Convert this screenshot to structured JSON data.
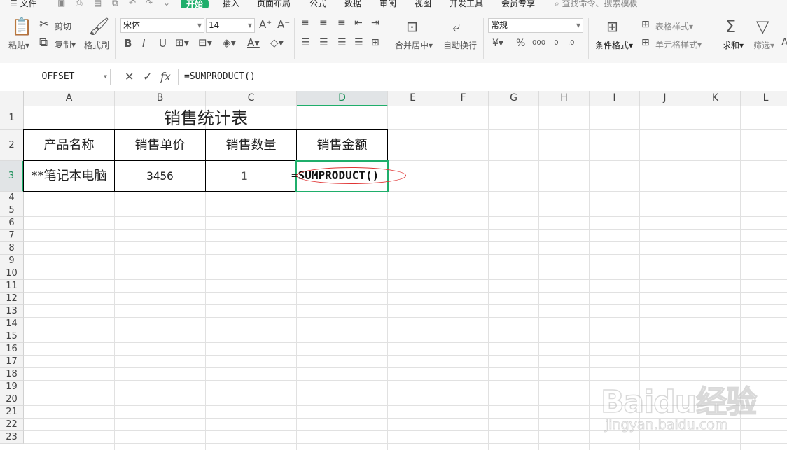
{
  "menu": {
    "file": "文件",
    "tabs": [
      "开始",
      "插入",
      "页面布局",
      "公式",
      "数据",
      "审阅",
      "视图",
      "开发工具",
      "会员专享"
    ],
    "search_placeholder": "查找命令、搜索模板"
  },
  "ribbon": {
    "paste": "粘贴",
    "cut": "剪切",
    "copy": "复制",
    "format_painter": "格式刷",
    "font_name": "宋体",
    "font_size": "14",
    "merge_center": "合并居中",
    "wrap_text": "自动换行",
    "number_format": "常规",
    "conditional_format": "条件格式",
    "table_style": "表格样式",
    "cell_style": "单元格样式",
    "sum": "求和",
    "filter": "筛选"
  },
  "formula_bar": {
    "name_box": "OFFSET",
    "fx_label": "fx",
    "formula": "=SUMPRODUCT()"
  },
  "sheet": {
    "columns": [
      "A",
      "B",
      "C",
      "D",
      "E",
      "F",
      "G",
      "H",
      "I",
      "J",
      "K",
      "L"
    ],
    "rows": [
      "1",
      "2",
      "3",
      "4",
      "5",
      "6",
      "7",
      "8",
      "9",
      "10",
      "11",
      "12",
      "13",
      "14",
      "15",
      "16",
      "17",
      "18",
      "19",
      "20",
      "21",
      "22",
      "23"
    ],
    "title": "销售统计表",
    "headers": [
      "产品名称",
      "销售单价",
      "销售数量",
      "销售金额"
    ],
    "row3": {
      "product": "**笔记本电脑",
      "price": "3456",
      "qty_partial": "1",
      "formula_eq": "=",
      "formula_fn": "SUMPRODUCT()"
    },
    "selected_column": "D",
    "selected_row": "3"
  },
  "watermark": {
    "main": "Baidu经验",
    "sub": "jingyan.baidu.com"
  }
}
